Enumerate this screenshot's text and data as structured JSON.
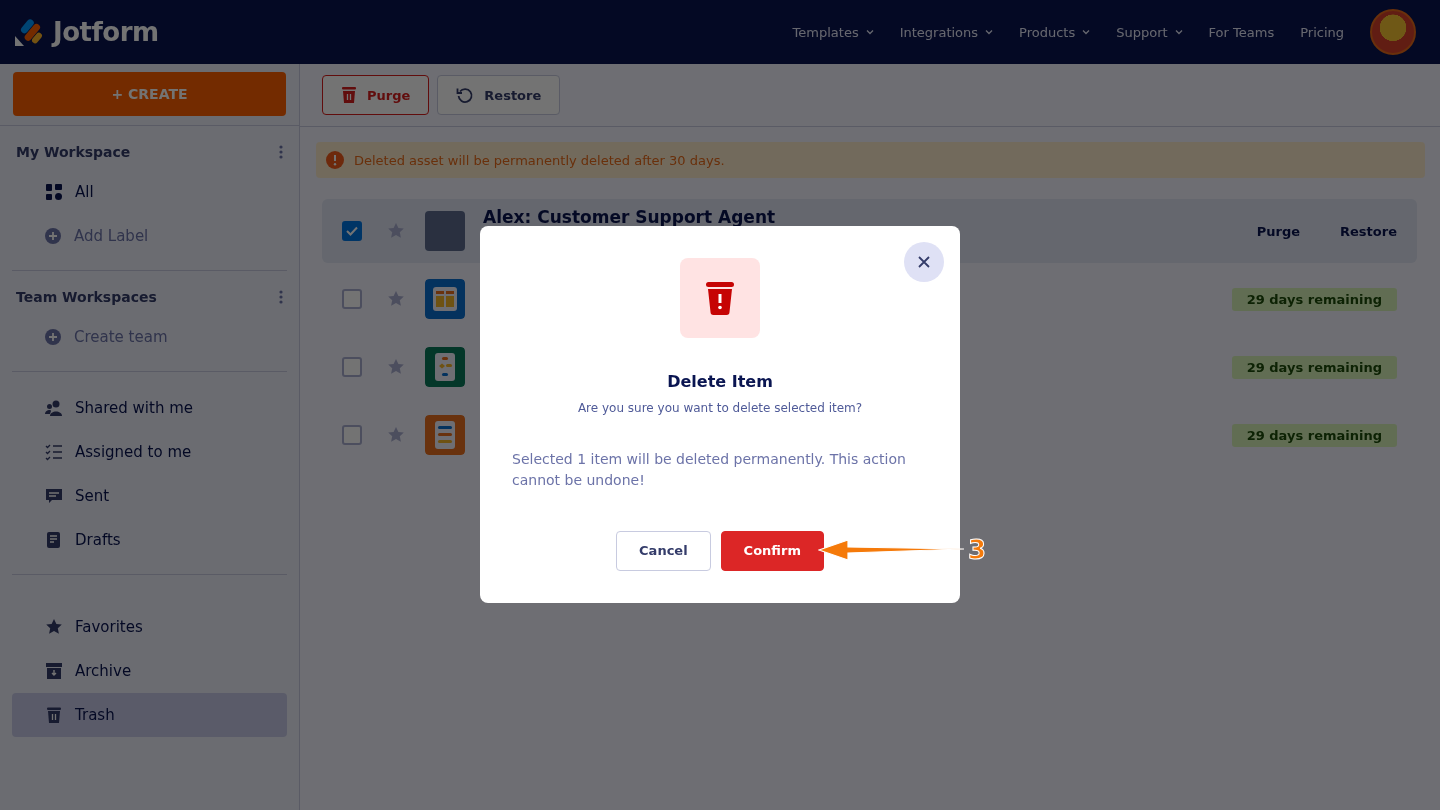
{
  "header": {
    "brand": "Jotform",
    "nav": [
      {
        "label": "Templates",
        "has_dropdown": true
      },
      {
        "label": "Integrations",
        "has_dropdown": true
      },
      {
        "label": "Products",
        "has_dropdown": true
      },
      {
        "label": "Support",
        "has_dropdown": true
      },
      {
        "label": "For Teams",
        "has_dropdown": false
      },
      {
        "label": "Pricing",
        "has_dropdown": false
      }
    ]
  },
  "sidebar": {
    "create_label": "+ CREATE",
    "sections": [
      {
        "heading": "My Workspace",
        "items": [
          {
            "kind": "all",
            "label": "All",
            "selected": false
          },
          {
            "kind": "add",
            "label": "Add Label",
            "selected": false
          }
        ]
      },
      {
        "heading": "Team Workspaces",
        "items": [
          {
            "kind": "add",
            "label": "Create team",
            "selected": false
          }
        ]
      },
      {
        "items": [
          {
            "kind": "shared",
            "label": "Shared with me",
            "selected": false
          },
          {
            "kind": "assigned",
            "label": "Assigned to me",
            "selected": false
          },
          {
            "kind": "sent",
            "label": "Sent",
            "selected": false
          },
          {
            "kind": "drafts",
            "label": "Drafts",
            "selected": false
          }
        ]
      },
      {
        "items": [
          {
            "kind": "favorites",
            "label": "Favorites",
            "selected": false
          },
          {
            "kind": "archive",
            "label": "Archive",
            "selected": false
          },
          {
            "kind": "trash",
            "label": "Trash",
            "selected": true
          }
        ]
      }
    ]
  },
  "toolbar": {
    "buttons": [
      {
        "kind": "purge",
        "label": "Purge"
      },
      {
        "kind": "restore",
        "label": "Restore"
      }
    ]
  },
  "notice": "Deleted asset will be permanently deleted after 30 days.",
  "items": [
    {
      "title": "Alex: Customer Support Agent",
      "checked": true,
      "kind": "agent",
      "actions": [
        "Purge",
        "Restore"
      ]
    },
    {
      "checked": false,
      "kind": "cards",
      "badge": "29 days remaining"
    },
    {
      "checked": false,
      "kind": "flow",
      "badge": "29 days remaining"
    },
    {
      "checked": false,
      "kind": "list",
      "badge": "29 days remaining"
    }
  ],
  "dialog": {
    "title": "Delete Item",
    "subtitle": "Are you sure you want to delete selected item?",
    "message": "Selected 1 item will be deleted permanently. This action cannot be undone!",
    "buttons": [
      {
        "kind": "secondary",
        "label": "Cancel"
      },
      {
        "kind": "danger",
        "label": "Confirm"
      }
    ]
  },
  "annotation": {
    "label": "3"
  }
}
